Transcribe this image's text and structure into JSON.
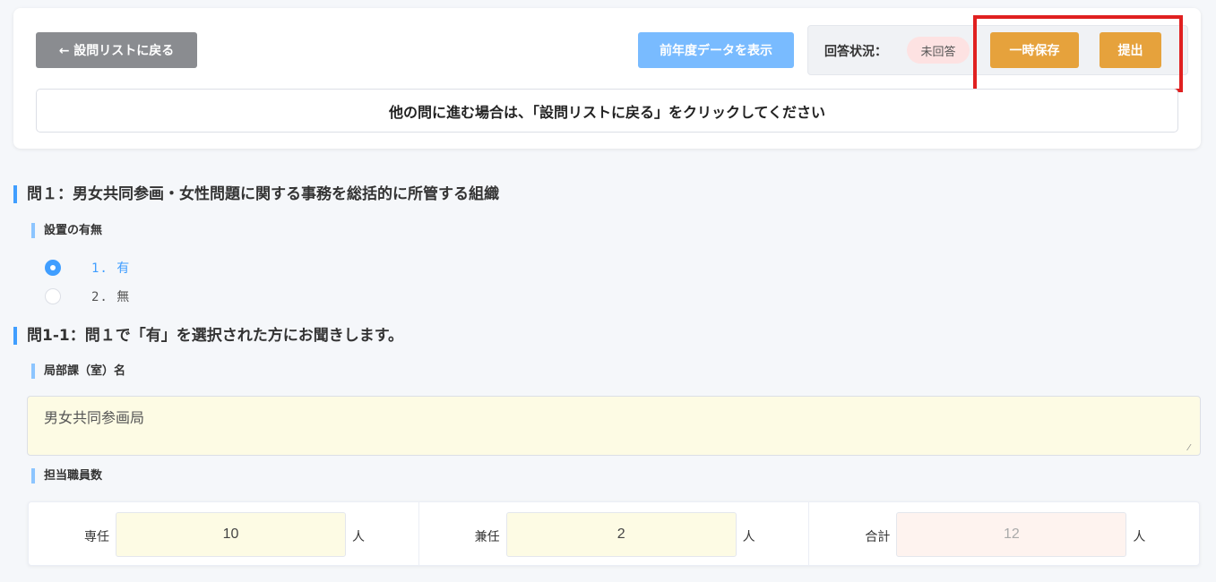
{
  "header": {
    "back_label": "← 設問リストに戻る",
    "prev_year_label": "前年度データを表示",
    "status_label": "回答状況：",
    "status_value": "未回答",
    "save_label": "一時保存",
    "submit_label": "提出",
    "notice": "他の問に進む場合は、「設問リストに戻る」をクリックしてください"
  },
  "q1": {
    "title": "問１：男女共同参画・女性問題に関する事務を総括的に所管する組織",
    "sub_label": "設置の有無",
    "options": [
      {
        "label": "1. 有",
        "checked": true
      },
      {
        "label": "2. 無",
        "checked": false
      }
    ]
  },
  "q1_1": {
    "title": "問1-1：問１で「有」を選択された方にお聞きします。",
    "dept_label": "局部課（室）名",
    "dept_value": "男女共同参画局",
    "staff_label": "担当職員数",
    "staff": [
      {
        "label": "専任",
        "value": "10",
        "unit": "人"
      },
      {
        "label": "兼任",
        "value": "2",
        "unit": "人"
      },
      {
        "label": "合計",
        "value": "12",
        "unit": "人"
      }
    ]
  },
  "colors": {
    "primary": "#409eff",
    "warning": "#e6a23c",
    "highlight": "#e02020",
    "input_yellow": "#fdfbe4"
  }
}
